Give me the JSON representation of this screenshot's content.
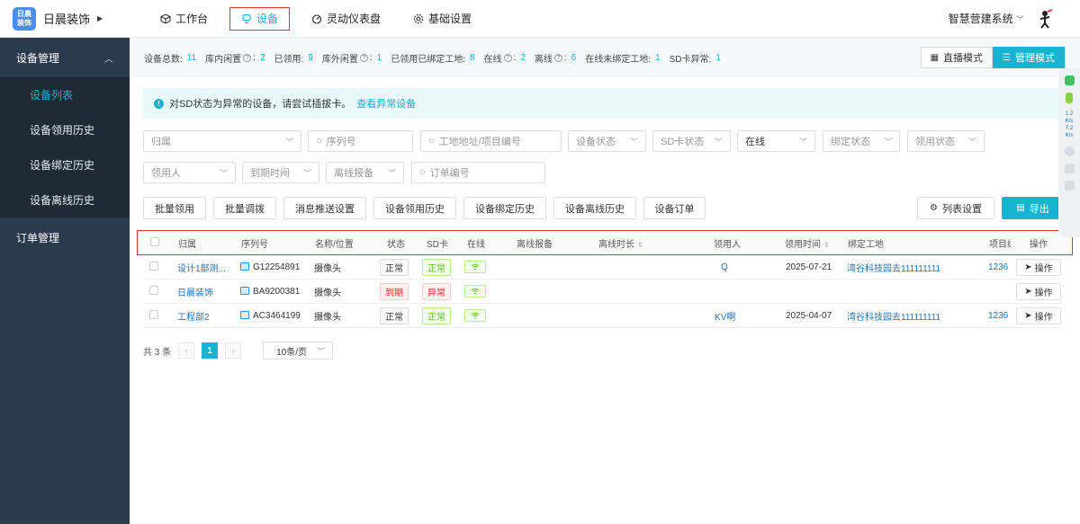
{
  "brand": {
    "logo_text": "日晨\n装饰",
    "name": "日晨装饰"
  },
  "topnav": [
    {
      "label": "工作台",
      "icon": "cube-icon"
    },
    {
      "label": "设备",
      "icon": "device-icon",
      "active": true
    },
    {
      "label": "灵动仪表盘",
      "icon": "gauge-icon"
    },
    {
      "label": "基础设置",
      "icon": "gear-icon"
    }
  ],
  "system": {
    "name": "智慧营建系统"
  },
  "sidebar": {
    "group1": "设备管理",
    "items": [
      "设备列表",
      "设备领用历史",
      "设备绑定历史",
      "设备离线历史"
    ],
    "group2": "订单管理"
  },
  "stats": [
    {
      "label": "设备总数:",
      "value": "11"
    },
    {
      "label": "库内闲置",
      "help": true,
      "value": "2"
    },
    {
      "label": "已领用:",
      "value": "9"
    },
    {
      "label": "库外闲置",
      "help": true,
      "value": "1"
    },
    {
      "label": "已领用已绑定工地:",
      "value": "8"
    },
    {
      "label": "在线",
      "help": true,
      "value": "2"
    },
    {
      "label": "离线",
      "help": true,
      "value": "6"
    },
    {
      "label": "在线未绑定工地:",
      "value": "1"
    },
    {
      "label": "SD卡异常:",
      "value": "1"
    }
  ],
  "modes": {
    "live": "直播模式",
    "manage": "管理模式"
  },
  "alert": {
    "text": "对SD状态为异常的设备，请尝试插拔卡。",
    "link": "查看异常设备"
  },
  "filters": {
    "owner": "归属",
    "serial": "序列号",
    "site": "工地地址/项目编号",
    "status": "设备状态",
    "sd": "SD卡状态",
    "online": "在线",
    "bind": "绑定状态",
    "claim": "领用状态",
    "claimer": "领用人",
    "expire": "到期时间",
    "offline": "离线报备",
    "order": "订单编号"
  },
  "actions": {
    "batch_claim": "批量领用",
    "batch_transfer": "批量调拨",
    "push": "消息推送设置",
    "claim_history": "设备领用历史",
    "bind_history": "设备绑定历史",
    "offline_history": "设备离线历史",
    "orders": "设备订单",
    "columns": "列表设置",
    "export": "导出"
  },
  "table": {
    "headers": {
      "owner": "归属",
      "serial": "序列号",
      "name": "名称/位置",
      "status": "状态",
      "sd": "SD卡",
      "online": "在线",
      "offline_report": "离线报备",
      "offline_dur": "离线时长",
      "claimer": "领用人",
      "claim_time": "领用时间",
      "site": "绑定工地",
      "project": "项目编",
      "op": "操作"
    },
    "rows": [
      {
        "owner": "设计1部测...",
        "serial": "G12254891",
        "name": "摄像头",
        "status": "正常",
        "status_type": "ok-plain",
        "sd": "正常",
        "sd_type": "ok",
        "claimer": "Q",
        "claim_time": "2025-07-21",
        "site": "湾谷科技园去111111111",
        "project": "1236",
        "op": "操作"
      },
      {
        "owner": "日晨装饰",
        "serial": "BA9200381",
        "name": "摄像头",
        "status": "到期",
        "status_type": "exp",
        "sd": "异常",
        "sd_type": "err",
        "claimer": "",
        "claim_time": "",
        "site": "",
        "project": "",
        "op": "操作"
      },
      {
        "owner": "工程部2",
        "serial": "AC3464199",
        "name": "摄像头",
        "status": "正常",
        "status_type": "ok-plain",
        "sd": "正常",
        "sd_type": "ok",
        "claimer": "KV啊",
        "claim_time": "2025-04-07",
        "site": "湾谷科技园去111111111",
        "project": "1236",
        "op": "操作"
      }
    ]
  },
  "pager": {
    "total": "共 3 条",
    "page": "1",
    "size": "10条/页"
  },
  "floater": {
    "t1": "1.2",
    "t2": "K/s",
    "t3": "7.2",
    "t4": "K/s"
  }
}
